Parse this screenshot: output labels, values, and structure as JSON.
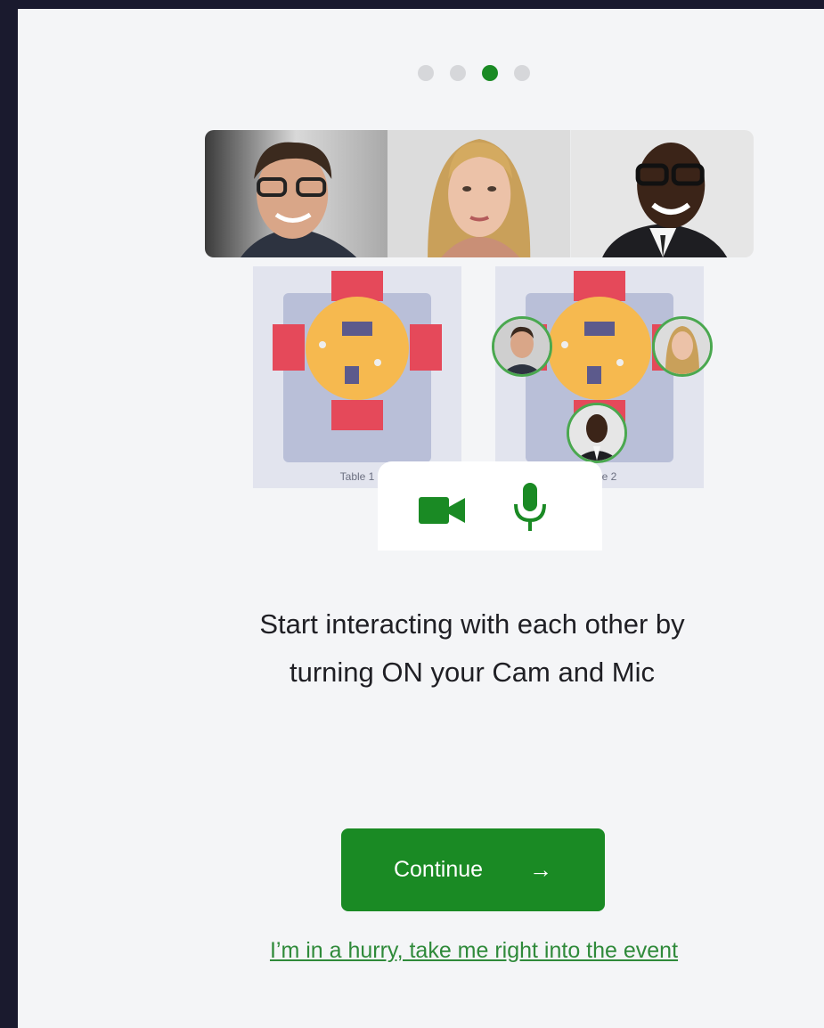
{
  "carousel": {
    "total_steps": 4,
    "current_step": 3
  },
  "tables": [
    {
      "label": "Table 1"
    },
    {
      "label": "Table 2"
    }
  ],
  "media": {
    "camera": "camera-icon",
    "microphone": "microphone-icon"
  },
  "headline": {
    "line1": "Start interacting with each other by",
    "line2": "turning ON your Cam and Mic"
  },
  "actions": {
    "continue_label": "Continue",
    "continue_icon": "→",
    "skip_link": "I’m in a hurry, take me right into the event"
  },
  "colors": {
    "accent": "#1a8a24",
    "link": "#2f8a3a",
    "panel": "#f4f5f7",
    "frame": "#1a1a2e"
  }
}
